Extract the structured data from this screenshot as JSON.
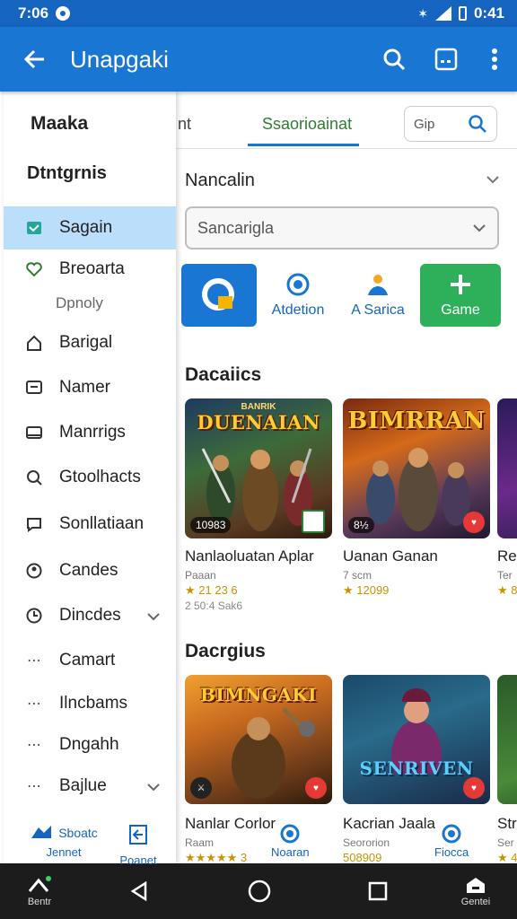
{
  "status_bar": {
    "time": "7:06",
    "battery": "0:41"
  },
  "app_bar": {
    "title": "Unapgaki"
  },
  "drawer": {
    "title": "Maaka",
    "subtitle": "Dtntgrnis",
    "items": [
      {
        "label": "Sagain",
        "icon": "inbox-icon",
        "active": true
      },
      {
        "label": "Breoarta",
        "icon": "heart-icon"
      },
      {
        "label": "Barigal",
        "icon": "home-icon"
      },
      {
        "label": "Namer",
        "icon": "message-icon"
      },
      {
        "label": "Manrrigs",
        "icon": "card-icon"
      },
      {
        "label": "Gtoolhacts",
        "icon": "search-plus-icon"
      },
      {
        "label": "Sonllatiaan",
        "icon": "chat-icon"
      },
      {
        "label": "Candes",
        "icon": "user-icon"
      },
      {
        "label": "Dincdes",
        "icon": "clock-icon"
      },
      {
        "label": "Camart",
        "icon": "dots-icon"
      },
      {
        "label": "Ilncbams",
        "icon": "dots-icon"
      },
      {
        "label": "Dngahh",
        "icon": "dots-icon"
      },
      {
        "label": "Bajlue",
        "icon": "dots-icon"
      }
    ],
    "note": "Dpnoly",
    "footer": {
      "left_top": "Sboatc",
      "left_bottom": "Jennet",
      "right_bottom": "Poanet"
    }
  },
  "tabs": {
    "left": "nt",
    "active": "Ssaorioainat",
    "search_text": "Gip"
  },
  "section_filter": {
    "title": "Nancalin",
    "dropdown_value": "Sancarigla"
  },
  "quick_actions": [
    {
      "label": "",
      "icon": "search-refresh-icon"
    },
    {
      "label": "Atdetion",
      "icon": "drop-icon"
    },
    {
      "label": "A Sarica",
      "icon": "people-icon"
    },
    {
      "label": "Game",
      "icon": "plus-icon"
    }
  ],
  "section_a": {
    "title": "Dacaiics",
    "cards": [
      {
        "art_title": "DUENAIAN",
        "art_sub": "BANRIK",
        "badge": "10983",
        "name": "Nanlaoluatan Aplar",
        "meta": "Paaan",
        "rating": "★ 21 23 6",
        "extra": "2 50:4 Sak6"
      },
      {
        "art_title": "BIMRRAN",
        "art_sub": "",
        "badge": "8½",
        "name": "Uanan Ganan",
        "meta": "7 scm",
        "rating": "★ 12099",
        "extra": ""
      },
      {
        "art_title": "",
        "art_sub": "",
        "badge": "",
        "name": "Re",
        "meta": "Ter",
        "rating": "★ 8",
        "extra": ""
      }
    ]
  },
  "section_b": {
    "title": "Dacrgius",
    "cards": [
      {
        "art_title": "BIMNGAKI",
        "art_sub": "",
        "name": "Nanlar Corlor",
        "meta": "Raam",
        "rating": "★★★★★ 3",
        "extra": ""
      },
      {
        "art_title": "SENRIVEN",
        "art_sub": "",
        "name": "Kacrian Jaala",
        "meta": "Seororion",
        "rating": "508909",
        "extra": ""
      },
      {
        "art_title": "",
        "art_sub": "",
        "name": "Str",
        "meta": "Ser",
        "rating": "★ 4",
        "extra": ""
      }
    ],
    "action_left": "Noaran",
    "action_right": "Fiocca"
  },
  "nav_bar": {
    "left_label": "Bentr",
    "right_label": "Gentei"
  },
  "colors": {
    "primary": "#1976d2",
    "status": "#1565c0",
    "accent_green": "#2eaf5a",
    "active_item": "#bbdefb"
  }
}
